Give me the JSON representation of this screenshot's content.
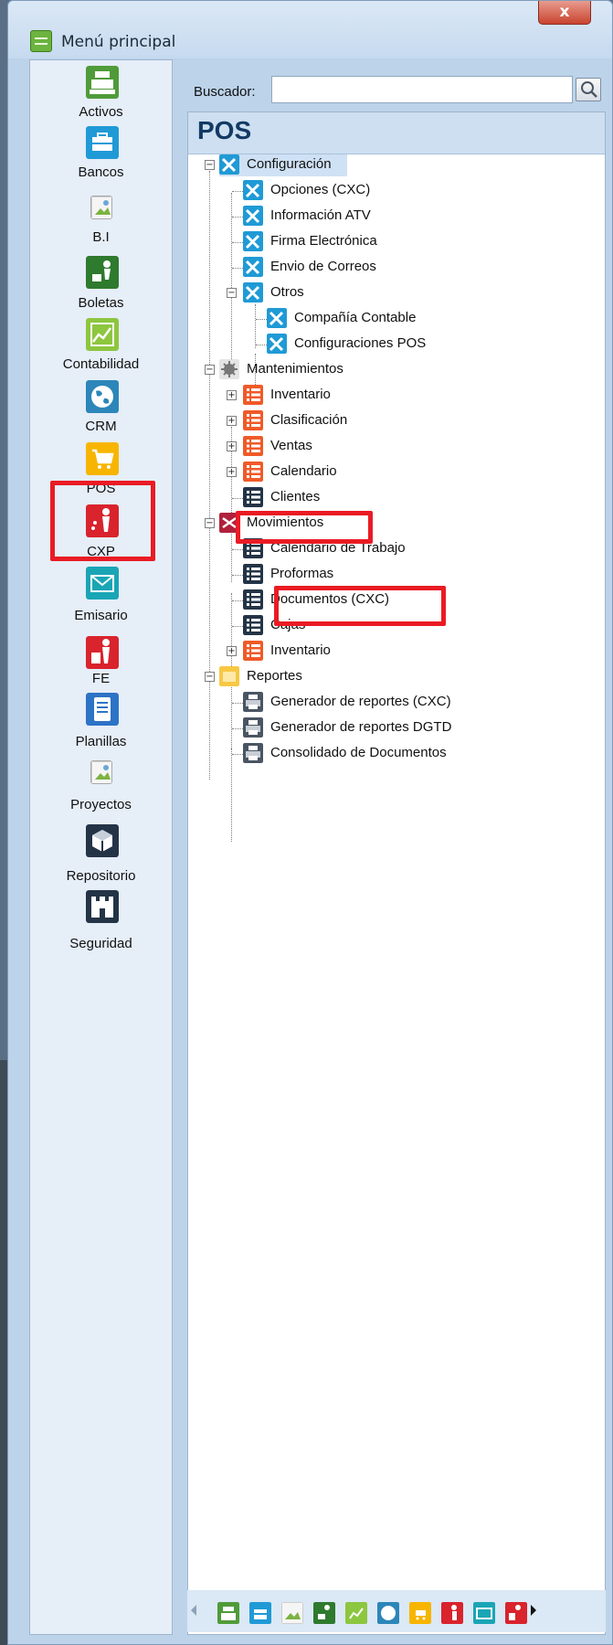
{
  "window": {
    "title": "Menú principal",
    "close_label": "x"
  },
  "sidebar": {
    "items": [
      {
        "label": "Activos",
        "icon": "cash-register-icon",
        "color": "#4f9b3a"
      },
      {
        "label": "Bancos",
        "icon": "briefcase-icon",
        "color": "#1f9ad6"
      },
      {
        "label": "B.I",
        "icon": "broken-image-icon",
        "color": "#f5f5f5"
      },
      {
        "label": "Boletas",
        "icon": "person-cart-icon",
        "color": "#2e7a2e"
      },
      {
        "label": "Contabilidad",
        "icon": "chart-icon",
        "color": "#8dc63f"
      },
      {
        "label": "CRM",
        "icon": "globe-icon",
        "color": "#2c86b9"
      },
      {
        "label": "POS",
        "icon": "shopping-cart-icon",
        "color": "#f7b500"
      },
      {
        "label": "CXP",
        "icon": "money-person-icon",
        "color": "#d9232d"
      },
      {
        "label": "Emisario",
        "icon": "envelope-icon",
        "color": "#1aa5b5"
      },
      {
        "label": "FE",
        "icon": "person-document-icon",
        "color": "#d9232d"
      },
      {
        "label": "Planillas",
        "icon": "document-list-icon",
        "color": "#2d73c6"
      },
      {
        "label": "Proyectos",
        "icon": "broken-image-icon",
        "color": "#f5f5f5"
      },
      {
        "label": "Repositorio",
        "icon": "cube-icon",
        "color": "#243447"
      },
      {
        "label": "Seguridad",
        "icon": "fortress-icon",
        "color": "#243447"
      }
    ],
    "active": "POS"
  },
  "search": {
    "label": "Buscador:",
    "value": "",
    "placeholder": ""
  },
  "tree": {
    "title": "POS",
    "nodes": [
      {
        "label": "Configuración",
        "icon": "wrench-icon",
        "level": 0,
        "expanded": true,
        "selected": true
      },
      {
        "label": "Opciones (CXC)",
        "icon": "wrench-icon",
        "level": 1
      },
      {
        "label": "Información ATV",
        "icon": "wrench-icon",
        "level": 1
      },
      {
        "label": "Firma Electrónica",
        "icon": "wrench-icon",
        "level": 1
      },
      {
        "label": "Envio de Correos",
        "icon": "wrench-icon",
        "level": 1
      },
      {
        "label": "Otros",
        "icon": "wrench-icon",
        "level": 1,
        "expanded": true
      },
      {
        "label": "Compañía Contable",
        "icon": "wrench-icon",
        "level": 2
      },
      {
        "label": "Configuraciones POS",
        "icon": "wrench-icon",
        "level": 2
      },
      {
        "label": "Mantenimientos",
        "icon": "gear-icon",
        "level": 0,
        "expanded": true
      },
      {
        "label": "Inventario",
        "icon": "list-icon",
        "level": 1,
        "collapsed": true
      },
      {
        "label": "Clasificación",
        "icon": "list-icon",
        "level": 1,
        "collapsed": true
      },
      {
        "label": "Ventas",
        "icon": "list-icon",
        "level": 1,
        "collapsed": true
      },
      {
        "label": "Calendario",
        "icon": "list-icon",
        "level": 1,
        "collapsed": true
      },
      {
        "label": "Clientes",
        "icon": "list-dark-icon",
        "level": 1
      },
      {
        "label": "Movimientos",
        "icon": "shuffle-icon",
        "level": 0,
        "expanded": true
      },
      {
        "label": "Calendario de Trabajo",
        "icon": "list-dark-icon",
        "level": 1
      },
      {
        "label": "Proformas",
        "icon": "list-dark-icon",
        "level": 1
      },
      {
        "label": "Documentos (CXC)",
        "icon": "list-dark-icon",
        "level": 1
      },
      {
        "label": "Cajas",
        "icon": "list-dark-icon",
        "level": 1
      },
      {
        "label": "Inventario",
        "icon": "list-icon",
        "level": 1,
        "collapsed": true
      },
      {
        "label": "Reportes",
        "icon": "folder-icon",
        "level": 0,
        "expanded": true
      },
      {
        "label": "Generador de reportes (CXC)",
        "icon": "printer-icon",
        "level": 1
      },
      {
        "label": "Generador de reportes DGTD",
        "icon": "printer-icon",
        "level": 1
      },
      {
        "label": "Consolidado de Documentos",
        "icon": "printer-icon",
        "level": 1
      }
    ]
  },
  "colors": {
    "highlight": "#ea1b24",
    "wrench": "#1f9ad6",
    "list_orange": "#f05a28",
    "list_dark": "#243447",
    "shuffle": "#b0203c",
    "folder": "#f7c843",
    "printer": "#4a5563",
    "gear": "#777777"
  }
}
